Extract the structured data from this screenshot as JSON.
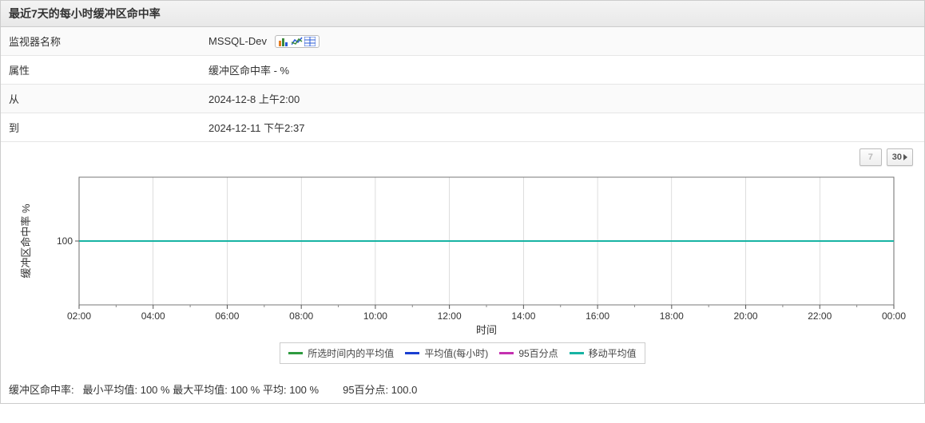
{
  "header": {
    "title": "最近7天的每小时缓冲区命中率"
  },
  "kv": [
    {
      "key": "监视器名称",
      "value": "MSSQL-Dev",
      "hasIcons": true
    },
    {
      "key": "属性",
      "value": "缓冲区命中率 - %"
    },
    {
      "key": "从",
      "value": "2024-12-8 上午2:00"
    },
    {
      "key": "到",
      "value": "2024-12-11 下午2:37"
    }
  ],
  "range_buttons": {
    "seven": "7",
    "thirty": "30"
  },
  "legend": [
    {
      "label": "所选时间内的平均值",
      "color": "#2e9b3f"
    },
    {
      "label": "平均值(每小时)",
      "color": "#1a3fd1"
    },
    {
      "label": "95百分点",
      "color": "#c430b0"
    },
    {
      "label": "移动平均值",
      "color": "#17b3a3"
    }
  ],
  "stats": {
    "label_title": "缓冲区命中率:",
    "min_label": "最小平均值:",
    "min_val": "100 %",
    "max_label": "最大平均值:",
    "max_val": "100 %",
    "avg_label": "平均:",
    "avg_val": "100 %",
    "p95_label": "95百分点:",
    "p95_val": "100.0"
  },
  "chart_data": {
    "type": "line",
    "title": "",
    "xlabel": "时间",
    "ylabel": "缓冲区命中率 %",
    "xticks": [
      "02:00",
      "04:00",
      "06:00",
      "08:00",
      "10:00",
      "12:00",
      "14:00",
      "16:00",
      "18:00",
      "20:00",
      "22:00",
      "00:00"
    ],
    "yticks": [
      100
    ],
    "ylim": [
      90,
      110
    ],
    "series": [
      {
        "name": "所选时间内的平均值",
        "color": "#2e9b3f",
        "x": [
          "02:00",
          "04:00",
          "06:00",
          "08:00",
          "10:00",
          "12:00",
          "14:00",
          "16:00",
          "18:00",
          "20:00",
          "22:00",
          "00:00"
        ],
        "y": [
          100,
          100,
          100,
          100,
          100,
          100,
          100,
          100,
          100,
          100,
          100,
          100
        ]
      },
      {
        "name": "平均值(每小时)",
        "color": "#1a3fd1",
        "x": [
          "02:00",
          "04:00",
          "06:00",
          "08:00",
          "10:00",
          "12:00",
          "14:00",
          "16:00",
          "18:00",
          "20:00",
          "22:00",
          "00:00"
        ],
        "y": [
          100,
          100,
          100,
          100,
          100,
          100,
          100,
          100,
          100,
          100,
          100,
          100
        ]
      },
      {
        "name": "95百分点",
        "color": "#c430b0",
        "x": [
          "02:00",
          "04:00",
          "06:00",
          "08:00",
          "10:00",
          "12:00",
          "14:00",
          "16:00",
          "18:00",
          "20:00",
          "22:00",
          "00:00"
        ],
        "y": [
          100,
          100,
          100,
          100,
          100,
          100,
          100,
          100,
          100,
          100,
          100,
          100
        ]
      },
      {
        "name": "移动平均值",
        "color": "#17b3a3",
        "x": [
          "02:00",
          "04:00",
          "06:00",
          "08:00",
          "10:00",
          "12:00",
          "14:00",
          "16:00",
          "18:00",
          "20:00",
          "22:00",
          "00:00"
        ],
        "y": [
          100,
          100,
          100,
          100,
          100,
          100,
          100,
          100,
          100,
          100,
          100,
          100
        ]
      }
    ]
  }
}
